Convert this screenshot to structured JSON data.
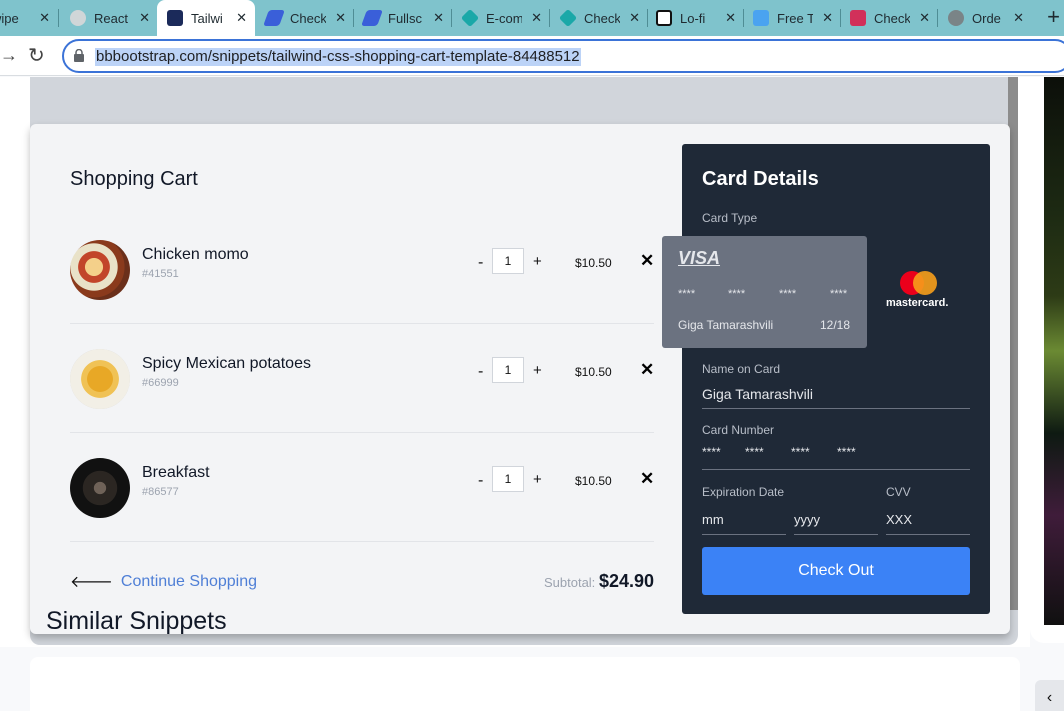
{
  "browser": {
    "tabs": [
      {
        "title": "wipe",
        "icon": "page-icon"
      },
      {
        "title": "React",
        "icon": "globe-icon"
      },
      {
        "title": "Tailwi",
        "icon": "tailwind-icon"
      },
      {
        "title": "Check",
        "icon": "stripe-icon"
      },
      {
        "title": "Fullsc",
        "icon": "stripe-icon"
      },
      {
        "title": "E-com",
        "icon": "shape-icon"
      },
      {
        "title": "Check",
        "icon": "shape-icon"
      },
      {
        "title": "Lo-fi",
        "icon": "codepen-icon"
      },
      {
        "title": "Free T",
        "icon": "cube-icon"
      },
      {
        "title": "Check",
        "icon": "app-icon"
      },
      {
        "title": "Orde",
        "icon": "globe-icon"
      }
    ],
    "new_tab": "+",
    "url": "bbbootstrap.com/snippets/tailwind-css-shopping-cart-template-84488512"
  },
  "cart": {
    "title": "Shopping Cart",
    "items": [
      {
        "name": "Chicken momo",
        "sku": "#41551",
        "qty": "1",
        "price": "$10.50",
        "minus": "-",
        "plus": "+"
      },
      {
        "name": "Spicy Mexican potatoes",
        "sku": "#66999",
        "qty": "1",
        "price": "$10.50",
        "minus": "-",
        "plus": "+"
      },
      {
        "name": "Breakfast",
        "sku": "#86577",
        "qty": "1",
        "price": "$10.50",
        "minus": "-",
        "plus": "+"
      }
    ],
    "continue_label": "Continue Shopping",
    "subtotal_label": "Subtotal:",
    "subtotal_value": "$24.90"
  },
  "card_details": {
    "title": "Card Details",
    "card_type_label": "Card Type",
    "visa": {
      "logo": "VISA",
      "number_groups": [
        "****",
        "****",
        "****",
        "****"
      ],
      "holder": "Giga Tamarashvili",
      "expiry": "12/18"
    },
    "mastercard_label": "mastercard.",
    "name_label": "Name on Card",
    "name_value": "Giga Tamarashvili",
    "number_label": "Card Number",
    "number_groups": [
      "****",
      "****",
      "****",
      "****"
    ],
    "expiration_label": "Expiration Date",
    "month_placeholder": "mm",
    "year_placeholder": "yyyy",
    "cvv_label": "CVV",
    "cvv_placeholder": "XXX",
    "checkout_label": "Check Out"
  },
  "similar_title": "Similar Snippets",
  "colors": {
    "accent": "#3b82f6",
    "panel": "#1f2937",
    "link": "#4f7fd6"
  }
}
